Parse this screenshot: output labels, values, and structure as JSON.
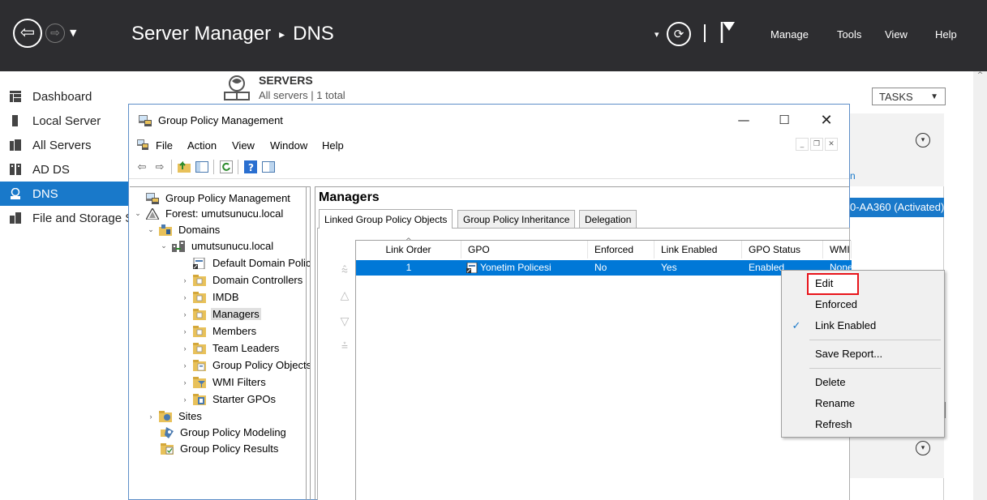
{
  "server_manager": {
    "title": "Server Manager",
    "separator": "▸",
    "section": "DNS",
    "menu": {
      "manage": "Manage",
      "tools": "Tools",
      "view": "View",
      "help": "Help"
    },
    "nav": [
      {
        "label": "Dashboard"
      },
      {
        "label": "Local Server"
      },
      {
        "label": "All Servers"
      },
      {
        "label": "AD DS"
      },
      {
        "label": "DNS",
        "active": true
      },
      {
        "label": "File and Storage Services"
      }
    ],
    "servers_tile": {
      "title": "SERVERS",
      "subtitle": "All servers | 1 total"
    },
    "tasks_label": "TASKS",
    "background_fragments": {
      "link_fragment": "n",
      "activated_fragment": "0-AA360 (Activated)"
    }
  },
  "gpmc": {
    "window_title": "Group Policy Management",
    "menus": [
      "File",
      "Action",
      "View",
      "Window",
      "Help"
    ],
    "tree": {
      "root": "Group Policy Management",
      "forest": "Forest: umutsunucu.local",
      "domains": "Domains",
      "domain": "umutsunucu.local",
      "children": [
        "Default Domain Policy",
        "Domain Controllers",
        "IMDB",
        "Managers",
        "Members",
        "Team Leaders",
        "Group Policy Objects",
        "WMI Filters",
        "Starter GPOs"
      ],
      "sites": "Sites",
      "modeling": "Group Policy Modeling",
      "results": "Group Policy Results"
    },
    "detail": {
      "title": "Managers",
      "tabs": [
        "Linked Group Policy Objects",
        "Group Policy Inheritance",
        "Delegation"
      ],
      "columns": [
        "Link Order",
        "GPO",
        "Enforced",
        "Link Enabled",
        "GPO Status",
        "WMI Filter"
      ],
      "rows": [
        {
          "link_order": "1",
          "gpo": "Yonetim Policesi",
          "enforced": "No",
          "link_enabled": "Yes",
          "gpo_status": "Enabled",
          "wmi": "None"
        }
      ]
    }
  },
  "context_menu": {
    "items": [
      "Edit",
      "Enforced",
      "Link Enabled",
      "Save Report...",
      "Delete",
      "Rename",
      "Refresh"
    ],
    "checked": "Link Enabled",
    "highlighted": "Edit",
    "highlight_color": "#e8141b"
  },
  "colors": {
    "accent": "#1979ca",
    "header_bg": "#2d2d30",
    "selection": "#0078d7"
  }
}
